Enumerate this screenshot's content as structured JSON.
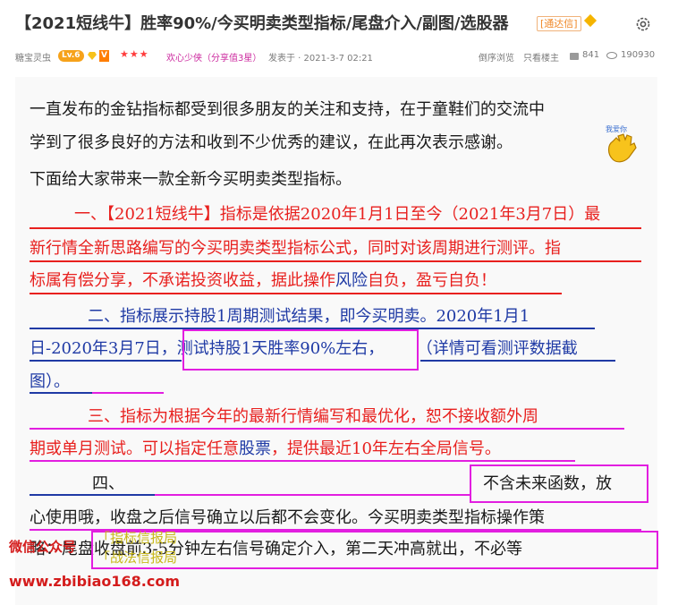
{
  "header": {
    "title": "【2021短线牛】胜率90%/今买明卖类型指标/尾盘介入/副图/选股器",
    "tag": "[通达信]"
  },
  "meta": {
    "author": "糖宝灵虫",
    "level": "Lv.6",
    "vip": "V",
    "stars": "★★★",
    "rank": "欢心少侠（分享值3星）",
    "posted": "发表于 · 2021-3-7 02:21",
    "reverse_view": "倒序浏览",
    "only_author": "只看楼主",
    "replies": "841",
    "views": "190930"
  },
  "post": {
    "l1": "一直发布的金钻指标都受到很多朋友的关注和支持，在于童鞋们的交流中",
    "l2": "学到了很多良好的方法和收到不少优秀的建议，在此再次表示感谢。",
    "sticker_text": "我爱你",
    "l3": "下面给大家带来一款全新今买明卖类型指标。",
    "s1_l1": "一、【2021短线牛】指标是依据2020年1月1日至今（2021年3月7日）最",
    "s1_l2": "新行情全新思路编写的今买明卖类型指标公式，同时对该周期进行测评。指",
    "s1_l3a": "标属有偿分享，不承诺投资收益，据此操作",
    "s1_l3_link": "风险",
    "s1_l3b": "自负，盈亏自负！",
    "s2_l1": "二、指标展示持股1周期测试结果，即今买明卖。2020年1月1",
    "s2_l2a": "日-2020年3月7日，",
    "s2_l2_box": "测试持股1天胜率90%左右，",
    "s2_l2b": "（详情可看测评数据截",
    "s2_l3": "图）。",
    "s3_l1": "三、指标为根据今年的最新行情编写和最优化，恕不接收额外周",
    "s3_l2a": "期或单月测试。可以指定任意",
    "s3_l2_link": "股票",
    "s3_l2b": "，提供最近10年左右全局信号。",
    "s4_label": "四、",
    "s4_box": "不含未来函数，放",
    "s4_l2": "心使用哦，收盘之后信号确立以后都不会变化。今买明卖类型指标操作策",
    "s4_l3": "略：尾盘收盘前3-5分钟左右信号确定介入，第二天冲高就出，不必等"
  },
  "watermark": {
    "wechat": "微信公众号",
    "tag1": "「指标信报局",
    "tag2": "「战法信报局",
    "url": "www.zbibiao168.com"
  },
  "colors": {
    "accent_red": "#e8201e",
    "accent_blue": "#1f3aa5",
    "highlight_magenta": "#e21ee0"
  }
}
